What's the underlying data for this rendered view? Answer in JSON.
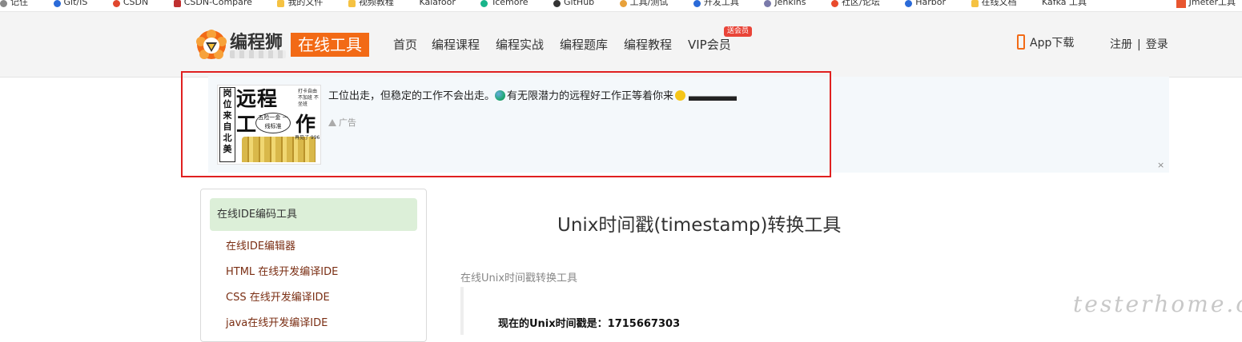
{
  "bookmarks": {
    "items": [
      "记住",
      "Git/IS",
      "CSDN",
      "CSDN-Compare",
      "我的文件",
      "视频教程",
      "Kalafoor",
      "Tcemore",
      "GitHub",
      "工具/测试",
      "开发工具",
      "Jenkins",
      "社区/论坛",
      "Harbor",
      "在线文档",
      "Kafka 工具"
    ],
    "last": "Jmeter工具"
  },
  "header": {
    "logo_text": "编程狮",
    "logo_badge": "在线工具",
    "nav": [
      "首页",
      "编程课程",
      "编程实战",
      "编程题库",
      "编程教程",
      "VIP会员"
    ],
    "vip_badge": "送会员",
    "app_download": "App下载",
    "register": "注册",
    "separator": "|",
    "login": "登录"
  },
  "ad": {
    "image": {
      "left_vertical": "岗位来自北美",
      "big1": "远程",
      "big2": "工",
      "big3": "作",
      "side": "打卡自由 不加班 不坐班",
      "bubble": "五险一金 一线标准",
      "extra": "再见了 996"
    },
    "text_part1": "工位出走，但稳定的工作不会出走。",
    "text_part2": "有无限潜力的远程好工作正等着你来",
    "label": "广告",
    "close": "×"
  },
  "sidebar": {
    "heading": "在线IDE编码工具",
    "links": [
      "在线IDE编辑器",
      "HTML 在线开发编译IDE",
      "CSS 在线开发编译IDE",
      "java在线开发编译IDE"
    ]
  },
  "main": {
    "title": "Unix时间戳(timestamp)转换工具",
    "section_label": "在线Unix时间戳转换工具",
    "timestamp_label": "现在的Unix时间戳是：",
    "timestamp_value": "1715667303"
  },
  "watermark": "testerhome.com",
  "colors": {
    "accent_orange": "#f26a16",
    "link_brown": "#7a2e13",
    "sidebar_head_bg": "#dcefd8",
    "highlight_red": "#e02020"
  }
}
